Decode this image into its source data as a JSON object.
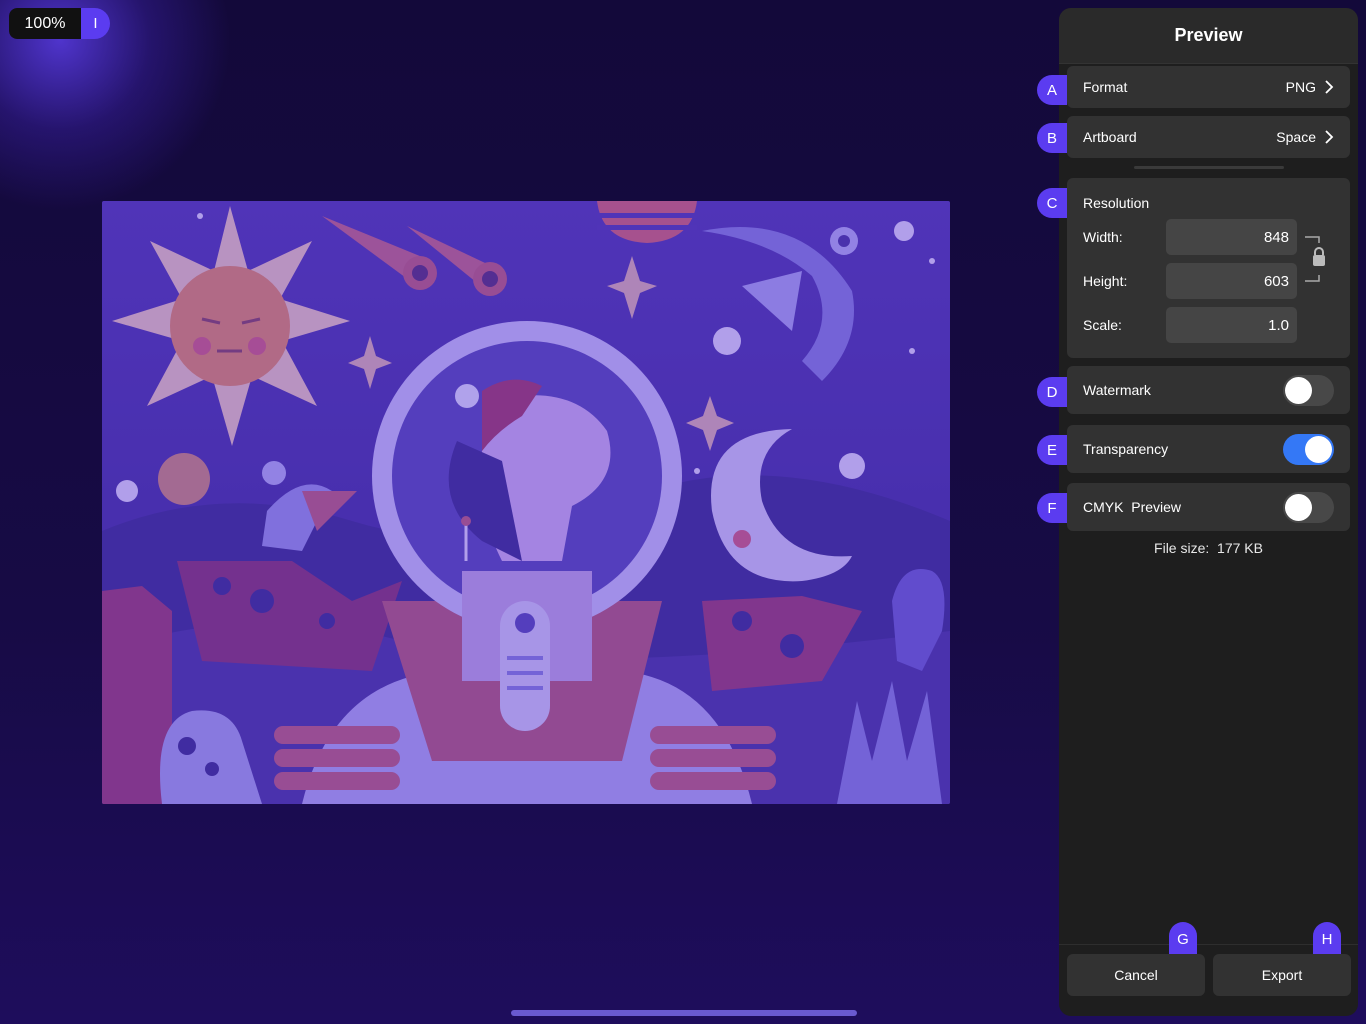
{
  "toolbar": {
    "zoom": "100%",
    "handle_glyph": "I"
  },
  "panel": {
    "title": "Preview",
    "format": {
      "label": "Format",
      "value": "PNG"
    },
    "artboard": {
      "label": "Artboard",
      "value": "Space"
    },
    "resolution": {
      "title": "Resolution",
      "width_label": "Width:",
      "width_value": "848",
      "height_label": "Height:",
      "height_value": "603",
      "scale_label": "Scale:",
      "scale_value": "1.0"
    },
    "watermark": {
      "label": "Watermark",
      "on": false
    },
    "transparency": {
      "label": "Transparency",
      "on": true
    },
    "cmyk": {
      "label": "CMYK  Preview",
      "on": false
    },
    "file_size": "File size:  177 KB",
    "cancel_label": "Cancel",
    "export_label": "Export"
  },
  "markers": {
    "a": "A",
    "b": "B",
    "c": "C",
    "d": "D",
    "e": "E",
    "f": "F",
    "g": "G",
    "h": "H"
  },
  "colors": {
    "accent": "#5b3cf0",
    "toggle_on": "#3478f6",
    "panel_bg": "#1e1e1e",
    "row_bg": "#323232"
  }
}
